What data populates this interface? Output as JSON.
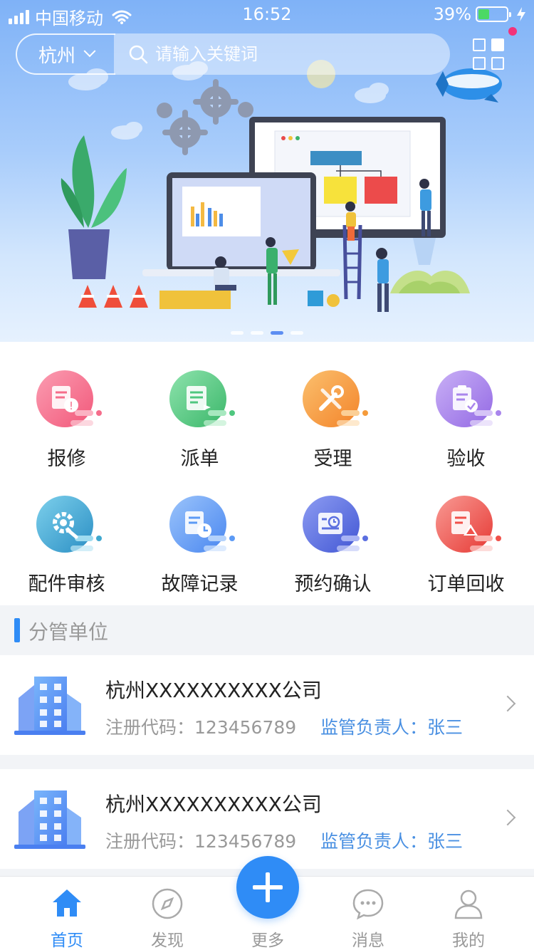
{
  "status_bar": {
    "carrier": "中国移动",
    "time": "16:52",
    "battery": "39%",
    "battery_level": 0.39,
    "icons": [
      "signal-icon",
      "wifi-icon",
      "battery-icon",
      "charging-icon"
    ]
  },
  "header": {
    "city": "杭州",
    "search_placeholder": "请输入关键词",
    "icons": [
      "chevron-down-icon",
      "search-icon",
      "apps-grid-icon"
    ]
  },
  "banner": {
    "slide_count": 4,
    "active_slide": 3
  },
  "grid": {
    "items": [
      {
        "label": "报修",
        "icon": "repair-report-icon",
        "color": "#f56d8b"
      },
      {
        "label": "派单",
        "icon": "dispatch-icon",
        "color": "#4fc77f"
      },
      {
        "label": "受理",
        "icon": "tools-icon",
        "color": "#f59b3a"
      },
      {
        "label": "验收",
        "icon": "acceptance-icon",
        "color": "#a985ec"
      },
      {
        "label": "配件审核",
        "icon": "parts-review-icon",
        "color": "#3fa8cf"
      },
      {
        "label": "故障记录",
        "icon": "fault-record-icon",
        "color": "#5c9af5"
      },
      {
        "label": "预约确认",
        "icon": "appointment-icon",
        "color": "#5b6fe0"
      },
      {
        "label": "订单回收",
        "icon": "order-recycle-icon",
        "color": "#f0514a"
      }
    ]
  },
  "section": {
    "title": "分管单位"
  },
  "companies": [
    {
      "name": "杭州XXXXXXXXXX公司",
      "code_label": "注册代码：",
      "code": "123456789",
      "supervisor_label": "监管负责人：",
      "supervisor": "张三"
    },
    {
      "name": "杭州XXXXXXXXXX公司",
      "code_label": "注册代码：",
      "code": "123456789",
      "supervisor_label": "监管负责人：",
      "supervisor": "张三"
    }
  ],
  "tabbar": {
    "tabs": [
      {
        "label": "首页",
        "icon": "home-icon",
        "active": true
      },
      {
        "label": "发现",
        "icon": "compass-icon",
        "active": false
      },
      {
        "label": "更多",
        "icon": "plus-icon",
        "active": false
      },
      {
        "label": "消息",
        "icon": "message-icon",
        "active": false
      },
      {
        "label": "我的",
        "icon": "user-icon",
        "active": false
      }
    ],
    "accent": "#2f8cf6",
    "inactive": "#999999"
  }
}
